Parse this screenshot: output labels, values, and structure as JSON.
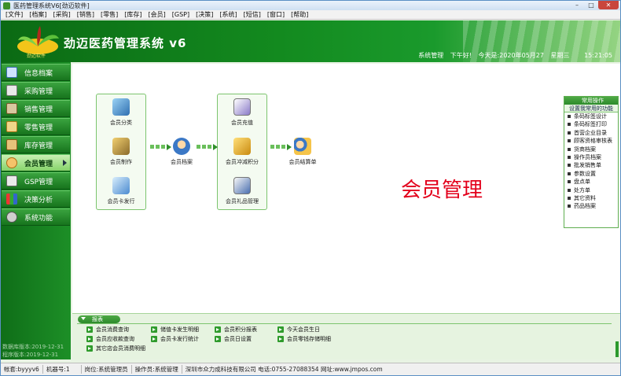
{
  "window": {
    "title": "医药管理系统V6[劲迈软件]"
  },
  "menu": [
    "[文件]",
    "[档案]",
    "[采购]",
    "[销售]",
    "[零售]",
    "[库存]",
    "[会员]",
    "[GSP]",
    "[决策]",
    "[系统]",
    "[短信]",
    "[窗口]",
    "[帮助]"
  ],
  "banner": {
    "brand": "劲迈软件",
    "app_title": "劲迈医药管理系统 v6",
    "status_user": "系统管理",
    "greeting": "下午好!",
    "date": "今天是:2020年05月27",
    "weekday": "星期三",
    "time": "15:21:05"
  },
  "sidebar": {
    "items": [
      {
        "label": "信息档案",
        "icon": "archive-icon"
      },
      {
        "label": "采购管理",
        "icon": "purchase-icon"
      },
      {
        "label": "销售管理",
        "icon": "sales-icon"
      },
      {
        "label": "零售管理",
        "icon": "retail-icon"
      },
      {
        "label": "库存管理",
        "icon": "stock-icon"
      },
      {
        "label": "会员管理",
        "icon": "members-icon",
        "active": true
      },
      {
        "label": "GSP管理",
        "icon": "gsp-icon"
      },
      {
        "label": "决策分析",
        "icon": "analysis-icon"
      },
      {
        "label": "系统功能",
        "icon": "settings-icon"
      }
    ],
    "info_line1": "数据库版本:2019-12-31",
    "info_line2": "程序版本:2019-12-31"
  },
  "workflow": {
    "group1": [
      "会员分类",
      "会员制作",
      "会员卡发行"
    ],
    "center": "会员档案",
    "group2": [
      "会员充值",
      "会员冲减积分",
      "会员礼品管理"
    ],
    "final": "会员结算单"
  },
  "page_heading": "会员管理",
  "right_panel": {
    "header": "常用操作",
    "subheader": "设置我常用的功能",
    "items": [
      "条码标签设计",
      "条码标签打印",
      "首营企业目录",
      "顾客资格审核表",
      "货商档案",
      "操作员档案",
      "批发销售单",
      "参数设置",
      "盘点单",
      "处方单",
      "其它资料",
      "药品档案"
    ]
  },
  "reports": {
    "header": "报表",
    "items": [
      [
        "会员消费查询",
        "储值卡发生明细",
        "会员积分报表",
        "今天会员生日"
      ],
      [
        "会员应收款查询",
        "会员卡发行统计",
        "会员日设置",
        "会员零钱存储明细"
      ],
      [
        "其它店会员消费明细"
      ]
    ]
  },
  "statusbar": [
    "帐套:byyyv6",
    "机器号:1",
    "岗位:系统管理员",
    "操作员:系统管理",
    "深圳市众力成科技有限公司 电话:0755-27088354 网址:www.jmpos.com"
  ],
  "colors": {
    "primary_green": "#1a8a24",
    "heading_red": "#e3001b"
  }
}
